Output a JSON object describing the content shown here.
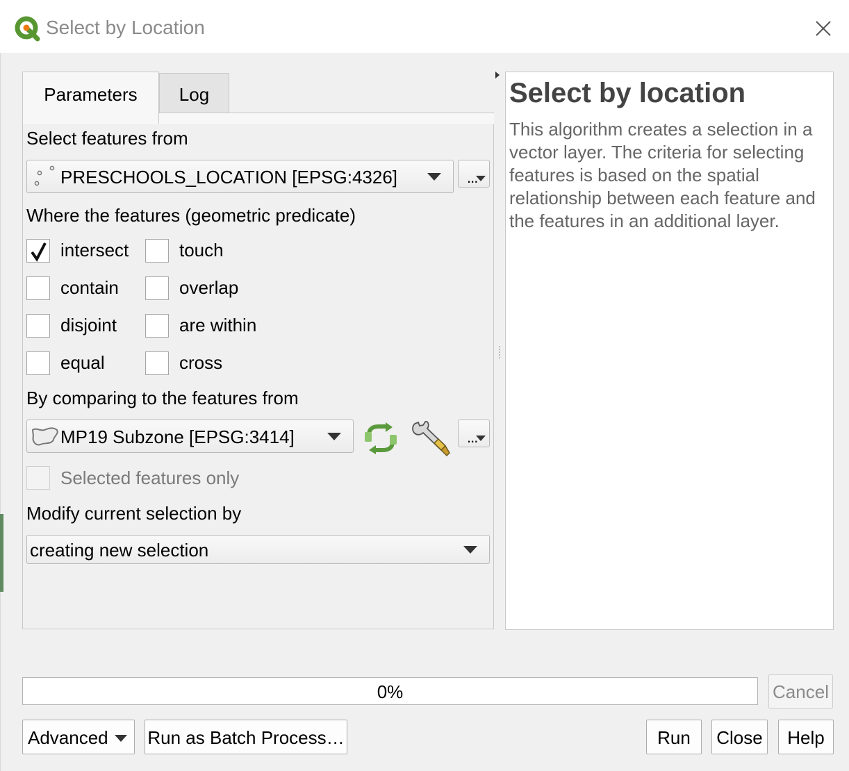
{
  "window": {
    "title": "Select by Location",
    "close_icon": "close-icon",
    "app_icon": "qgis-logo-icon"
  },
  "tabs": [
    {
      "label": "Parameters",
      "active": true
    },
    {
      "label": "Log",
      "active": false
    }
  ],
  "params": {
    "input_label": "Select features from",
    "input_layer": {
      "value": "PRESCHOOLS_LOCATION [EPSG:4326]",
      "icon": "point-layer-icon"
    },
    "predicate_label": "Where the features (geometric predicate)",
    "predicates": [
      {
        "label": "intersect",
        "checked": true
      },
      {
        "label": "touch",
        "checked": false
      },
      {
        "label": "contain",
        "checked": false
      },
      {
        "label": "overlap",
        "checked": false
      },
      {
        "label": "disjoint",
        "checked": false
      },
      {
        "label": "are within",
        "checked": false
      },
      {
        "label": "equal",
        "checked": false
      },
      {
        "label": "cross",
        "checked": false
      }
    ],
    "compare_label": "By comparing to the features from",
    "compare_layer": {
      "value": "MP19 Subzone [EPSG:3414]",
      "icon": "polygon-layer-icon"
    },
    "selected_only_label": "Selected features only",
    "modify_label": "Modify current selection by",
    "modify_value": "creating new selection",
    "more_button": "..."
  },
  "help": {
    "title": "Select by location",
    "body": "This algorithm creates a selection in a vector layer. The criteria for selecting features is based on the spatial relationship between each feature and the features in an additional layer."
  },
  "progress": {
    "value": 0,
    "text": "0%"
  },
  "buttons": {
    "cancel": "Cancel",
    "advanced": "Advanced",
    "batch": "Run as Batch Process…",
    "run": "Run",
    "close": "Close",
    "help": "Help"
  },
  "colors": {
    "qgis_green": "#589632",
    "qgis_yellow": "#ee7913",
    "help_title": "#444444",
    "help_body": "#666666"
  }
}
